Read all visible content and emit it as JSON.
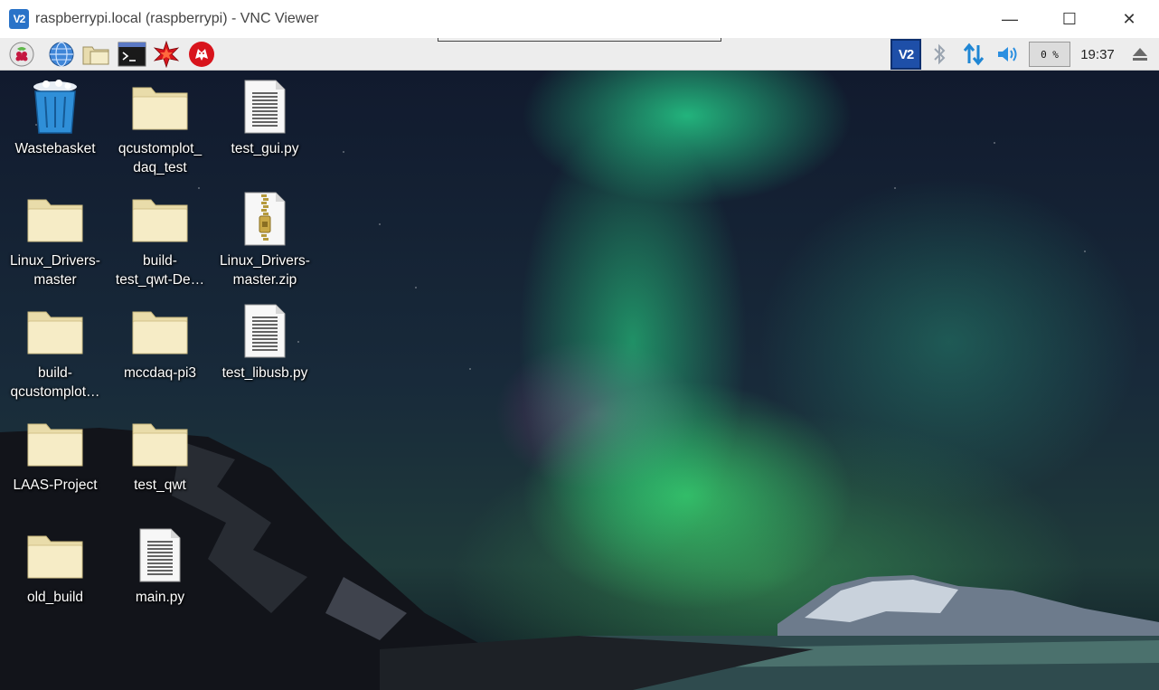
{
  "window": {
    "title": "raspberrypi.local (raspberrypi) - VNC Viewer",
    "app_badge": "V2",
    "controls": {
      "minimize": "—",
      "maximize": "☐",
      "close": "✕"
    }
  },
  "panel": {
    "launchers": [
      {
        "name": "raspberry-menu-icon"
      },
      {
        "name": "web-browser-icon"
      },
      {
        "name": "file-manager-icon"
      },
      {
        "name": "terminal-icon"
      },
      {
        "name": "mathematica-icon"
      },
      {
        "name": "wolfram-icon"
      }
    ],
    "tray": {
      "vnc_badge": "V2",
      "cpu_usage": "0 %",
      "clock": "19:37"
    }
  },
  "desktop": {
    "icons": [
      {
        "label_lines": [
          "Wastebasket"
        ],
        "type": "trash"
      },
      {
        "label_lines": [
          "qcustomplot_",
          "daq_test"
        ],
        "type": "folder"
      },
      {
        "label_lines": [
          "test_gui.py"
        ],
        "type": "file"
      },
      {
        "label_lines": [
          "Linux_Drivers-",
          "master"
        ],
        "type": "folder"
      },
      {
        "label_lines": [
          "build-",
          "test_qwt-De…"
        ],
        "type": "folder"
      },
      {
        "label_lines": [
          "Linux_Drivers-",
          "master.zip"
        ],
        "type": "zip"
      },
      {
        "label_lines": [
          "build-",
          "qcustomplot…"
        ],
        "type": "folder"
      },
      {
        "label_lines": [
          "mccdaq-pi3"
        ],
        "type": "folder"
      },
      {
        "label_lines": [
          "test_libusb.py"
        ],
        "type": "file"
      },
      {
        "label_lines": [
          "LAAS-Project"
        ],
        "type": "folder"
      },
      {
        "label_lines": [
          "test_qwt"
        ],
        "type": "folder"
      },
      {
        "label_lines": [
          "old_build"
        ],
        "type": "folder"
      },
      {
        "label_lines": [
          "main.py"
        ],
        "type": "file"
      }
    ]
  },
  "colors": {
    "accent": "#2a73c8",
    "folder": "#f4e8b6",
    "trash": "#2f8fd8"
  }
}
